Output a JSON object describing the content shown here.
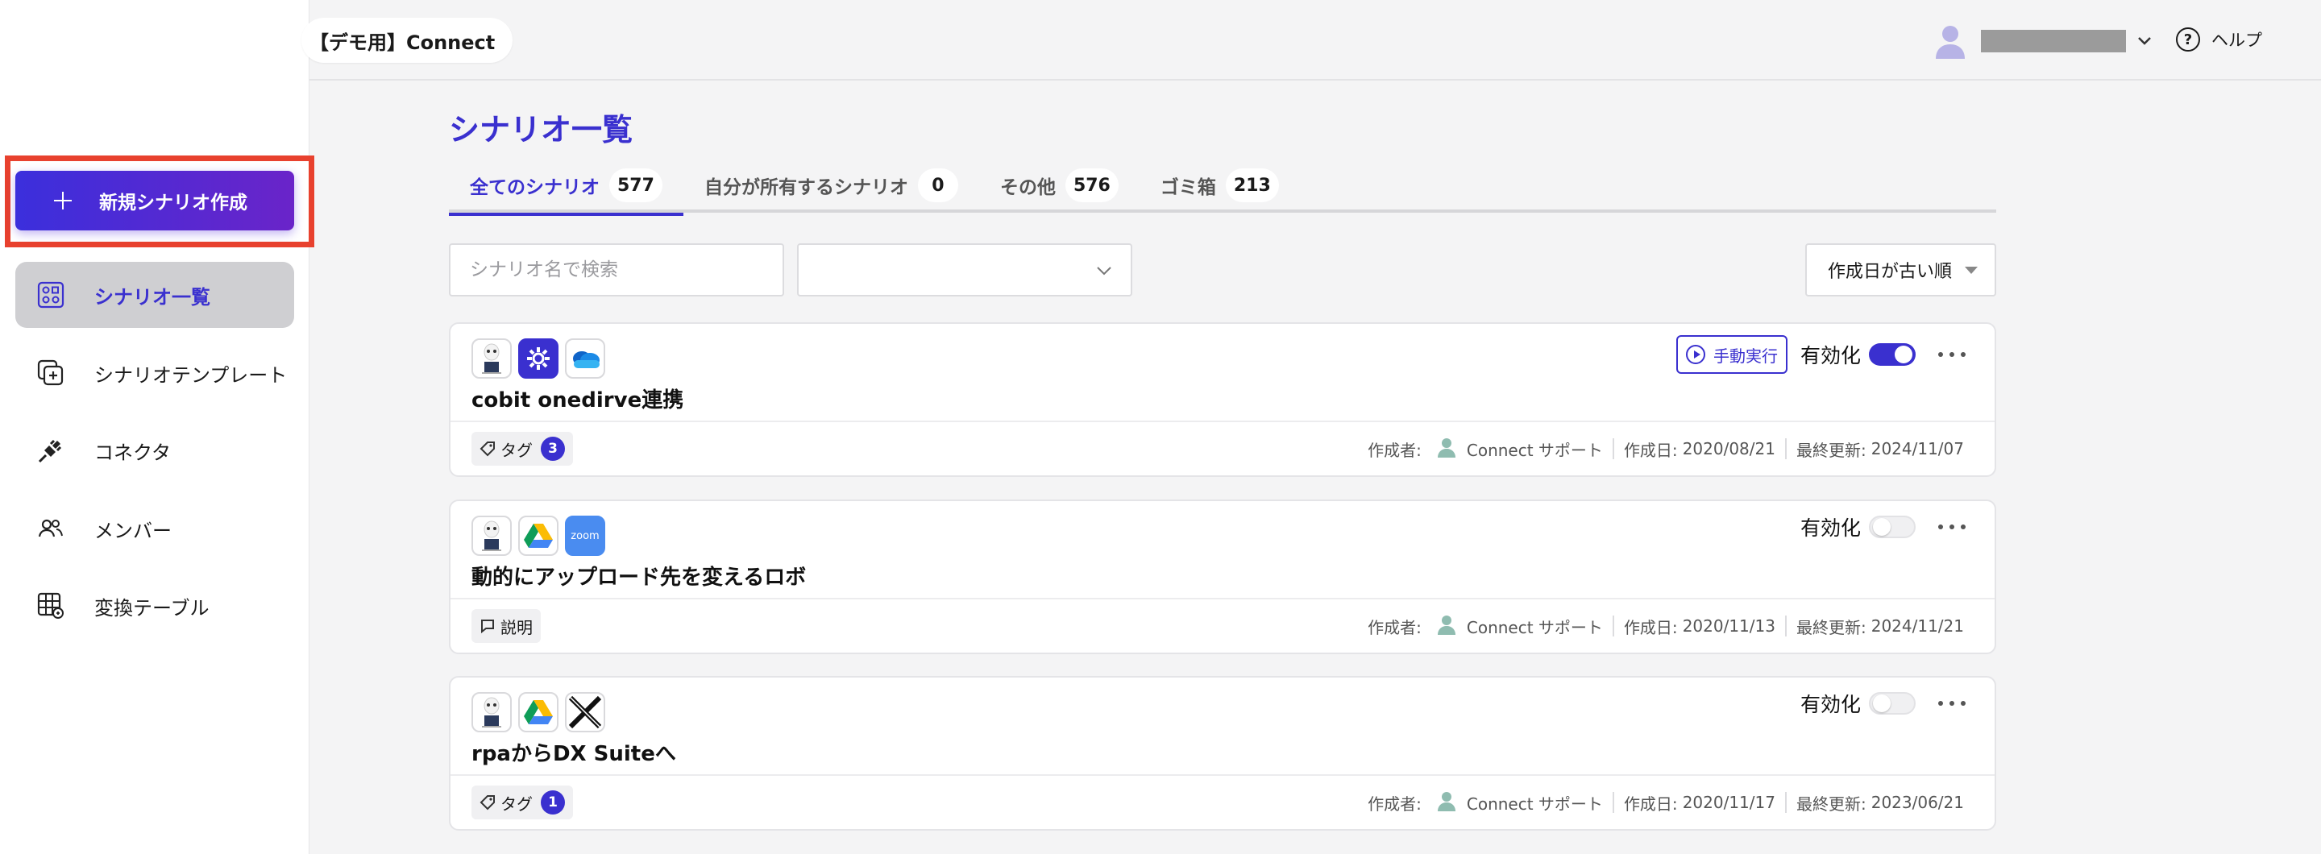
{
  "org": {
    "name": "【デモ用】Connect"
  },
  "header": {
    "help_label": "ヘルプ"
  },
  "sidebar": {
    "new_button_label": "新規シナリオ作成",
    "items": [
      {
        "label": "シナリオ一覧",
        "icon": "scenario-grid-icon",
        "active": true
      },
      {
        "label": "シナリオテンプレート",
        "icon": "template-add-icon"
      },
      {
        "label": "コネクタ",
        "icon": "connector-plug-icon"
      },
      {
        "label": "メンバー",
        "icon": "members-icon"
      },
      {
        "label": "変換テーブル",
        "icon": "table-convert-icon"
      }
    ]
  },
  "main": {
    "title": "シナリオ一覧",
    "tabs": [
      {
        "label": "全てのシナリオ",
        "count": "577",
        "active": true
      },
      {
        "label": "自分が所有するシナリオ",
        "count": "0"
      },
      {
        "label": "その他",
        "count": "576"
      },
      {
        "label": "ゴミ箱",
        "count": "213"
      }
    ],
    "search_placeholder": "シナリオ名で検索",
    "sort_label": "作成日が古い順",
    "enable_label": "有効化",
    "run_label": "手動実行",
    "creator_label": "作成者:",
    "created_label": "作成日:",
    "updated_label": "最終更新:"
  },
  "scenarios": [
    {
      "title": "cobit onedirve連携",
      "icons": [
        "robot-icon",
        "gear-app-icon",
        "onedrive-icon"
      ],
      "badge_label": "タグ",
      "badge_count": "3",
      "creator": "Connect サポート",
      "created": "2020/08/21",
      "updated": "2024/11/07",
      "enabled": true,
      "manual_run": true
    },
    {
      "title": "動的にアップロード先を変えるロボ",
      "icons": [
        "robot-icon",
        "google-drive-icon",
        "zoom-icon"
      ],
      "badge_label": "説明",
      "badge_count": "",
      "creator": "Connect サポート",
      "created": "2020/11/13",
      "updated": "2024/11/21",
      "enabled": false,
      "manual_run": false,
      "zoom_text": "zoom"
    },
    {
      "title": "rpaからDX Suiteへ",
      "icons": [
        "robot-icon",
        "google-drive-icon",
        "x-logo-icon"
      ],
      "badge_label": "タグ",
      "badge_count": "1",
      "creator": "Connect サポート",
      "created": "2020/11/17",
      "updated": "2023/06/21",
      "enabled": false,
      "manual_run": false
    }
  ],
  "colors": {
    "accent": "#3a30cf",
    "highlight": "#e8412e",
    "gradient_end": "#6a24c9"
  }
}
